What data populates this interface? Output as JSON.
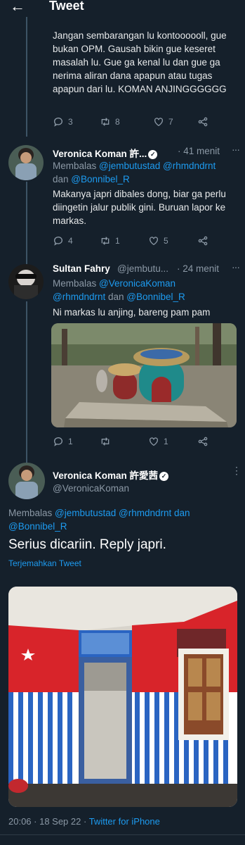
{
  "header": {
    "title": "Tweet"
  },
  "tweets": [
    {
      "text": "Jangan sembarangan lu kontoooooll, gue bukan OPM. Gausah bikin gue keseret masalah lu. Gue ga kenal lu dan gue ga nerima aliran dana apapun atau tugas apapun dari lu. KOMAN ANJINGGGGGG",
      "replies": "3",
      "retweets": "8",
      "likes": "7"
    },
    {
      "name": "Veronica Koman 許...",
      "time": "· 41 menit",
      "reply_prefix": "Membalas",
      "reply_line1": "@jembutustad @rhmdndrnt",
      "reply_dan": "dan",
      "reply_line2": "@Bonnibel_R",
      "text": "Makanya japri dibales dong, biar ga perlu diingetin jalur publik gini. Buruan lapor ke markas.",
      "replies": "4",
      "retweets": "1",
      "likes": "5"
    },
    {
      "name": "Sultan Fahry",
      "handle": "@jembutu...",
      "time": "· 24 menit",
      "reply_prefix": "Membalas",
      "reply_line1": "@VeronicaKoman",
      "reply_line2a": "@rhmdndrnt",
      "reply_dan": "dan",
      "reply_line2b": "@Bonnibel_R",
      "text": "Ni markas lu anjing, bareng pam pam",
      "replies": "1",
      "retweets": "",
      "likes": "1"
    }
  ],
  "main_tweet": {
    "name": "Veronica Koman 許愛茜",
    "handle": "@VeronicaKoman",
    "reply_prefix": "Membalas",
    "reply_line1": "@jembutustad @rhmdndrnt dan",
    "reply_line2": "@Bonnibel_R",
    "text": "Serius dicariin. Reply japri.",
    "translate": "Terjemahkan Tweet",
    "timestamp": "20:06 · 18 Sep 22 ·",
    "source": "Twitter for iPhone"
  },
  "icons": {
    "back": "arrow-left-icon",
    "reply": "reply-icon",
    "retweet": "retweet-icon",
    "like": "heart-icon",
    "share": "share-icon",
    "verified": "verified-badge-icon",
    "more": "more-icon"
  },
  "colors": {
    "background": "#15202b",
    "link": "#1d9bf0",
    "muted": "#8b98a5"
  }
}
